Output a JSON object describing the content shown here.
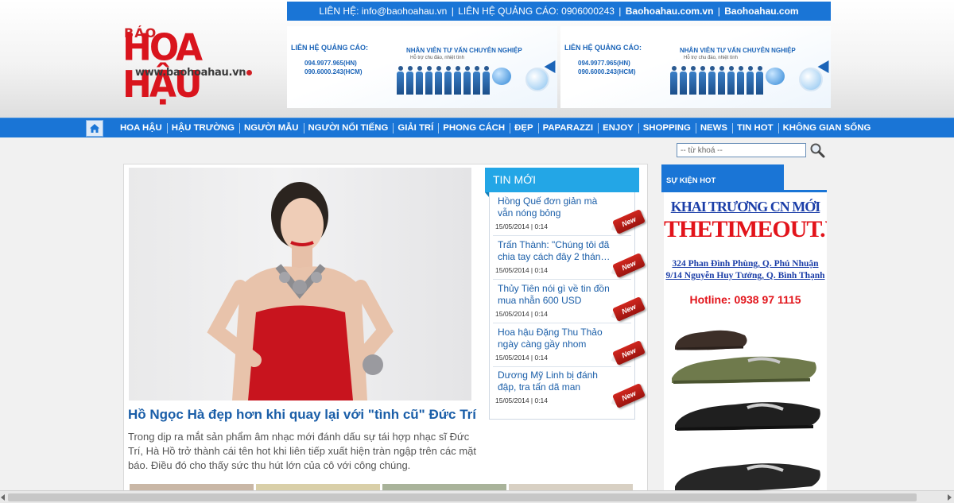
{
  "topbar": {
    "contact": "LIÊN HỆ: info@baohoahau.vn",
    "ads_contact": "LIÊN HỆ QUẢNG CÁO: 0906000243",
    "site1": "Baohoahau.com.vn",
    "site2": "Baohoahau.com",
    "separator": "|"
  },
  "logo": {
    "bao": "BÁO",
    "name": "HOA HẬU",
    "url": "www.baohoahau.vn"
  },
  "banners": [
    {
      "title": "LIÊN HỆ QUẢNG CÁO:",
      "phone1": "094.9977.965(HN)",
      "phone2": "090.6000.243(HCM)",
      "headline": "NHÂN VIÊN TƯ VẤN CHUYÊN NGHIỆP",
      "sub": "Hỗ trợ chu đáo, nhiệt tình"
    },
    {
      "title": "LIÊN HỆ QUẢNG CÁO:",
      "phone1": "094.9977.965(HN)",
      "phone2": "090.6000.243(HCM)",
      "headline": "NHÂN VIÊN TƯ VẤN CHUYÊN NGHIỆP",
      "sub": "Hỗ trợ chu đáo, nhiệt tình"
    }
  ],
  "nav": {
    "home_icon": "home-icon",
    "items": [
      "HOA HẬU",
      "HẬU TRƯỜNG",
      "NGƯỜI MẪU",
      "NGƯỜI NỔI TIẾNG",
      "GIẢI TRÍ",
      "PHONG CÁCH",
      "ĐẸP",
      "PAPARAZZI",
      "ENJOY",
      "SHOPPING",
      "NEWS",
      "TIN HOT",
      "KHÔNG GIAN SỐNG"
    ]
  },
  "search": {
    "placeholder": "-- từ khoá --",
    "icon": "magnifier-icon"
  },
  "featured": {
    "title": "Hồ Ngọc Hà đẹp hơn khi quay lại với \"tình cũ\" Đức Trí",
    "description": "Trong dịp ra mắt sản phẩm âm nhạc mới đánh dấu sự tái hợp nhạc sĩ Đức Trí, Hà Hồ trở thành cái tên hot khi liên tiếp xuất hiện tràn ngập trên các mặt báo. Điều đó cho thấy sức thu hút lớn của cô với công chúng."
  },
  "tinmoi": {
    "label": "TIN MỚI",
    "badge": "New",
    "items": [
      {
        "title": "Hồng Quế đơn giản mà vẫn nóng bỏng",
        "date": "15/05/2014 | 0:14"
      },
      {
        "title": "Trấn Thành: \"Chúng tôi đã chia tay cách đây 2 thán…",
        "date": "15/05/2014 | 0:14"
      },
      {
        "title": "Thủy Tiên nói gì về tin đồn mua nhẫn 600 USD",
        "date": "15/05/2014 | 0:14"
      },
      {
        "title": "Hoa hậu Đặng Thu Thảo ngày càng gầy nhom",
        "date": "15/05/2014 | 0:14"
      },
      {
        "title": "Dương Mỹ Linh bị đánh đập, tra tấn dã man",
        "date": "15/05/2014 | 0:14"
      }
    ]
  },
  "hot": {
    "label": "SỰ KIỆN HOT",
    "ad_line1": "KHAI TRƯƠNG CN MỚI",
    "ad_brand": "THETIMEOUT.VN",
    "ad_addr1": "324 Phan Đình Phùng, Q. Phú Nhuận",
    "ad_addr2": "9/14 Nguyễn Huy Tưởng, Q. Bình Thạnh",
    "ad_hotline": "Hotline:  0938 97 1115"
  },
  "colors": {
    "brand_blue": "#1a75d6",
    "brand_red": "#d9141d",
    "tab_cyan": "#23a6e6"
  }
}
